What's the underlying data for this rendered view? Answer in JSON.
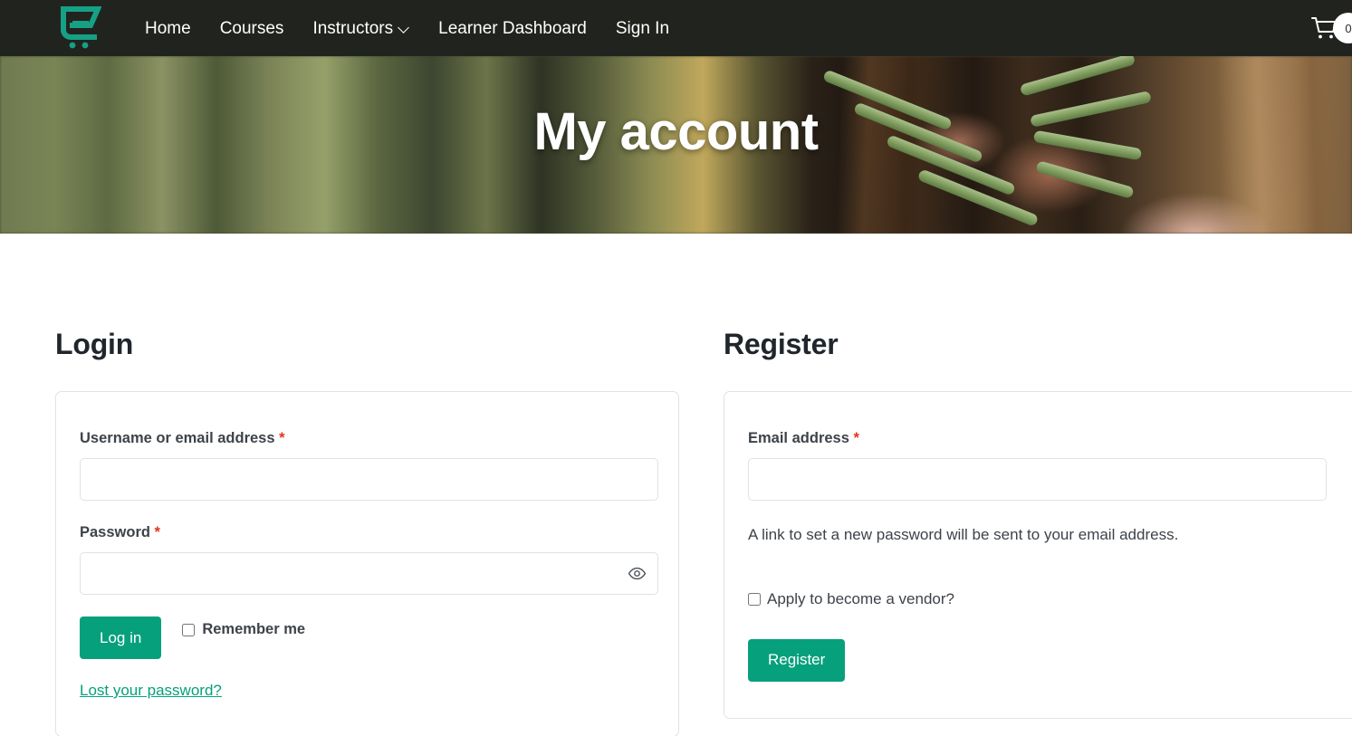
{
  "nav": {
    "logo_name": "shopping-cart-e-logo",
    "links": [
      {
        "label": "Home",
        "has_caret": false
      },
      {
        "label": "Courses",
        "has_caret": false
      },
      {
        "label": "Instructors",
        "has_caret": true
      },
      {
        "label": "Learner Dashboard",
        "has_caret": false
      },
      {
        "label": "Sign In",
        "has_caret": false
      }
    ],
    "cart": {
      "icon": "shopping-cart-icon",
      "count": "0"
    },
    "background_color": "#21231f"
  },
  "hero": {
    "title": "My account"
  },
  "login": {
    "heading": "Login",
    "username": {
      "label": "Username or email address",
      "required_marker": "*",
      "value": "",
      "placeholder": ""
    },
    "password": {
      "label": "Password",
      "required_marker": "*",
      "value": "",
      "placeholder": "",
      "toggle_icon": "eye-icon"
    },
    "submit_label": "Log in",
    "remember_label": "Remember me",
    "remember_checked": false,
    "lost_password_label": "Lost your password?"
  },
  "register": {
    "heading": "Register",
    "email": {
      "label": "Email address",
      "required_marker": "*",
      "value": "",
      "placeholder": ""
    },
    "helper_text": "A link to set a new password will be sent to your email address.",
    "vendor_label": "Apply to become a vendor?",
    "vendor_checked": false,
    "submit_label": "Register"
  },
  "colors": {
    "accent": "#07a07c",
    "nav_bg": "#21231f",
    "required": "#e2341d",
    "border": "#dce3ea",
    "text": "#3d4349",
    "heading": "#20262c"
  }
}
